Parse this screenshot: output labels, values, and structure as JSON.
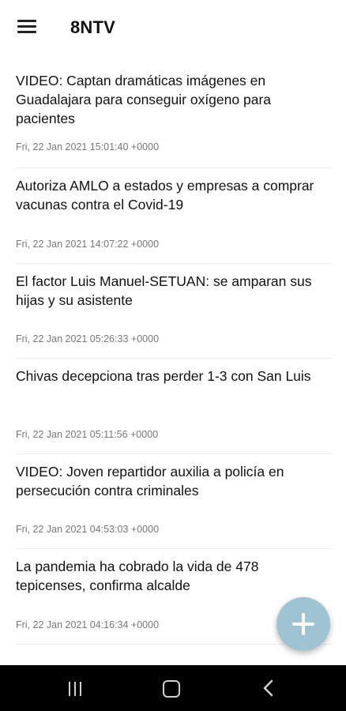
{
  "app": {
    "title": "8NTV",
    "menu_icon": "hamburger-menu-icon"
  },
  "articles": [
    {
      "title": "VIDEO: Captan dramáticas imágenes en Guadalajara para conseguir oxígeno para pacientes",
      "date": "Fri, 22 Jan 2021 15:01:40 +0000"
    },
    {
      "title": "Autoriza AMLO a estados y empresas a comprar vacunas contra el Covid-19",
      "date": "Fri, 22 Jan 2021 14:07:22 +0000"
    },
    {
      "title": "El factor Luis Manuel-SETUAN: se amparan sus hijas y su asistente",
      "date": "Fri, 22 Jan 2021 05:26:33 +0000"
    },
    {
      "title": "Chivas decepciona tras perder 1-3 con San Luis",
      "date": "Fri, 22 Jan 2021 05:11:56 +0000"
    },
    {
      "title": "VIDEO: Joven repartidor auxilia a policía en persecución contra criminales",
      "date": "Fri, 22 Jan 2021 04:53:03 +0000"
    },
    {
      "title": "La pandemia ha cobrado la vida de 478 tepicenses, confirma alcalde",
      "date": "Fri, 22 Jan 2021 04:16:34 +0000"
    }
  ],
  "fab": {
    "icon": "plus-icon",
    "color": "#9fc3d3"
  },
  "navbar": {
    "recent_icon": "recent-apps-icon",
    "home_icon": "home-icon",
    "back_icon": "back-icon"
  }
}
